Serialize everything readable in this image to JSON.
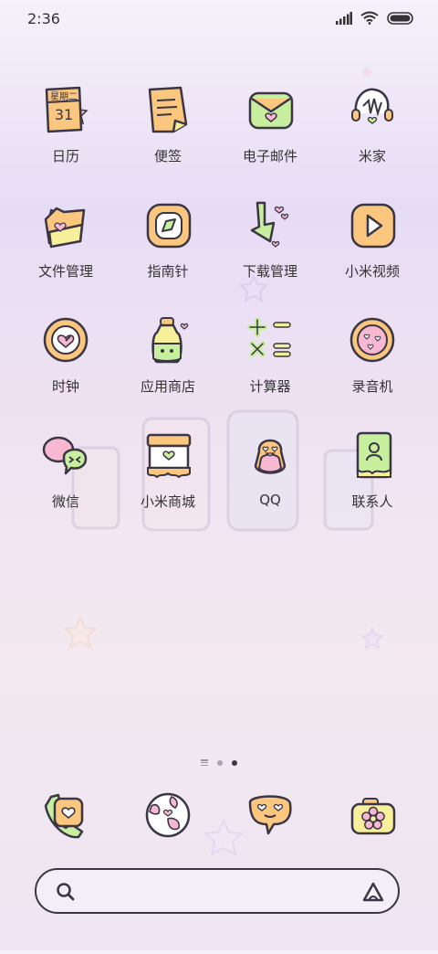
{
  "status_bar": {
    "time": "2:36"
  },
  "apps": [
    {
      "name": "calendar",
      "label": "日历",
      "icon": "calendar-icon",
      "badge_text": "星期二",
      "date_text": "31"
    },
    {
      "name": "notes",
      "label": "便签",
      "icon": "notes-icon"
    },
    {
      "name": "email",
      "label": "电子邮件",
      "icon": "envelope-icon"
    },
    {
      "name": "mihome",
      "label": "米家",
      "icon": "mihome-icon"
    },
    {
      "name": "files",
      "label": "文件管理",
      "icon": "folder-icon"
    },
    {
      "name": "compass",
      "label": "指南针",
      "icon": "compass-icon"
    },
    {
      "name": "downloads",
      "label": "下载管理",
      "icon": "download-icon"
    },
    {
      "name": "mivideo",
      "label": "小米视频",
      "icon": "play-icon"
    },
    {
      "name": "clock",
      "label": "时钟",
      "icon": "clock-icon"
    },
    {
      "name": "appstore",
      "label": "应用商店",
      "icon": "bottle-icon"
    },
    {
      "name": "calculator",
      "label": "计算器",
      "icon": "calculator-icon"
    },
    {
      "name": "recorder",
      "label": "录音机",
      "icon": "recorder-icon"
    },
    {
      "name": "wechat",
      "label": "微信",
      "icon": "chat-bubbles-icon"
    },
    {
      "name": "mistore",
      "label": "小米商城",
      "icon": "shop-icon"
    },
    {
      "name": "qq",
      "label": "QQ",
      "icon": "penguin-icon"
    },
    {
      "name": "contacts",
      "label": "联系人",
      "icon": "contact-card-icon"
    }
  ],
  "dock": [
    {
      "name": "phone",
      "icon": "phone-icon"
    },
    {
      "name": "browser",
      "icon": "globe-icon"
    },
    {
      "name": "messages",
      "icon": "message-bubble-icon"
    },
    {
      "name": "camera",
      "icon": "camera-icon"
    }
  ],
  "pager": {
    "pages": 2,
    "current": 2
  },
  "search": {
    "placeholder": ""
  },
  "colors": {
    "orange": "#fbc77f",
    "green": "#c8ef9e",
    "yellow": "#f7ef9a",
    "pink": "#f8b8d2",
    "stroke": "#3a3646"
  }
}
